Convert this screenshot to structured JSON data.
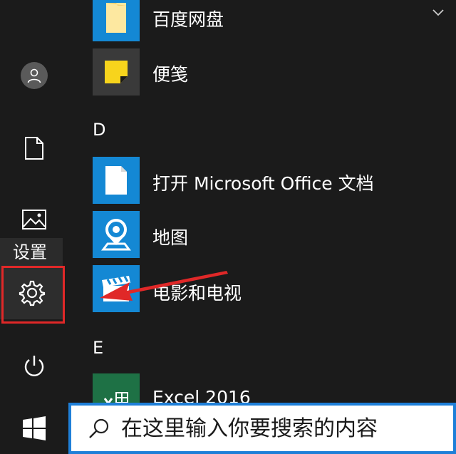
{
  "rail": {
    "user_icon": "user-icon",
    "documents_icon": "document-icon",
    "pictures_icon": "picture-icon",
    "settings_tooltip": "设置",
    "settings_icon": "gear-icon",
    "power_icon": "power-icon",
    "start_icon": "windows-logo-icon"
  },
  "app_list": {
    "items": [
      {
        "label": "百度网盘",
        "tile_color": "#1488d4"
      },
      {
        "label": "便笺",
        "tile_color": "#3a3a3a"
      }
    ],
    "group_d": {
      "letter": "D",
      "items": [
        {
          "label": "打开 Microsoft Office 文档",
          "tile_color": "#1488d4"
        },
        {
          "label": "地图",
          "tile_color": "#1488d4"
        },
        {
          "label": "电影和电视",
          "tile_color": "#1488d4"
        }
      ]
    },
    "group_e": {
      "letter": "E",
      "items": [
        {
          "label": "Excel 2016",
          "tile_color": "#1e7145"
        }
      ]
    }
  },
  "search": {
    "placeholder": "在这里输入你要搜索的内容",
    "accent": "#1e7fd8"
  },
  "colors": {
    "background": "#1b1b1b",
    "annotation_red": "#e02828"
  }
}
